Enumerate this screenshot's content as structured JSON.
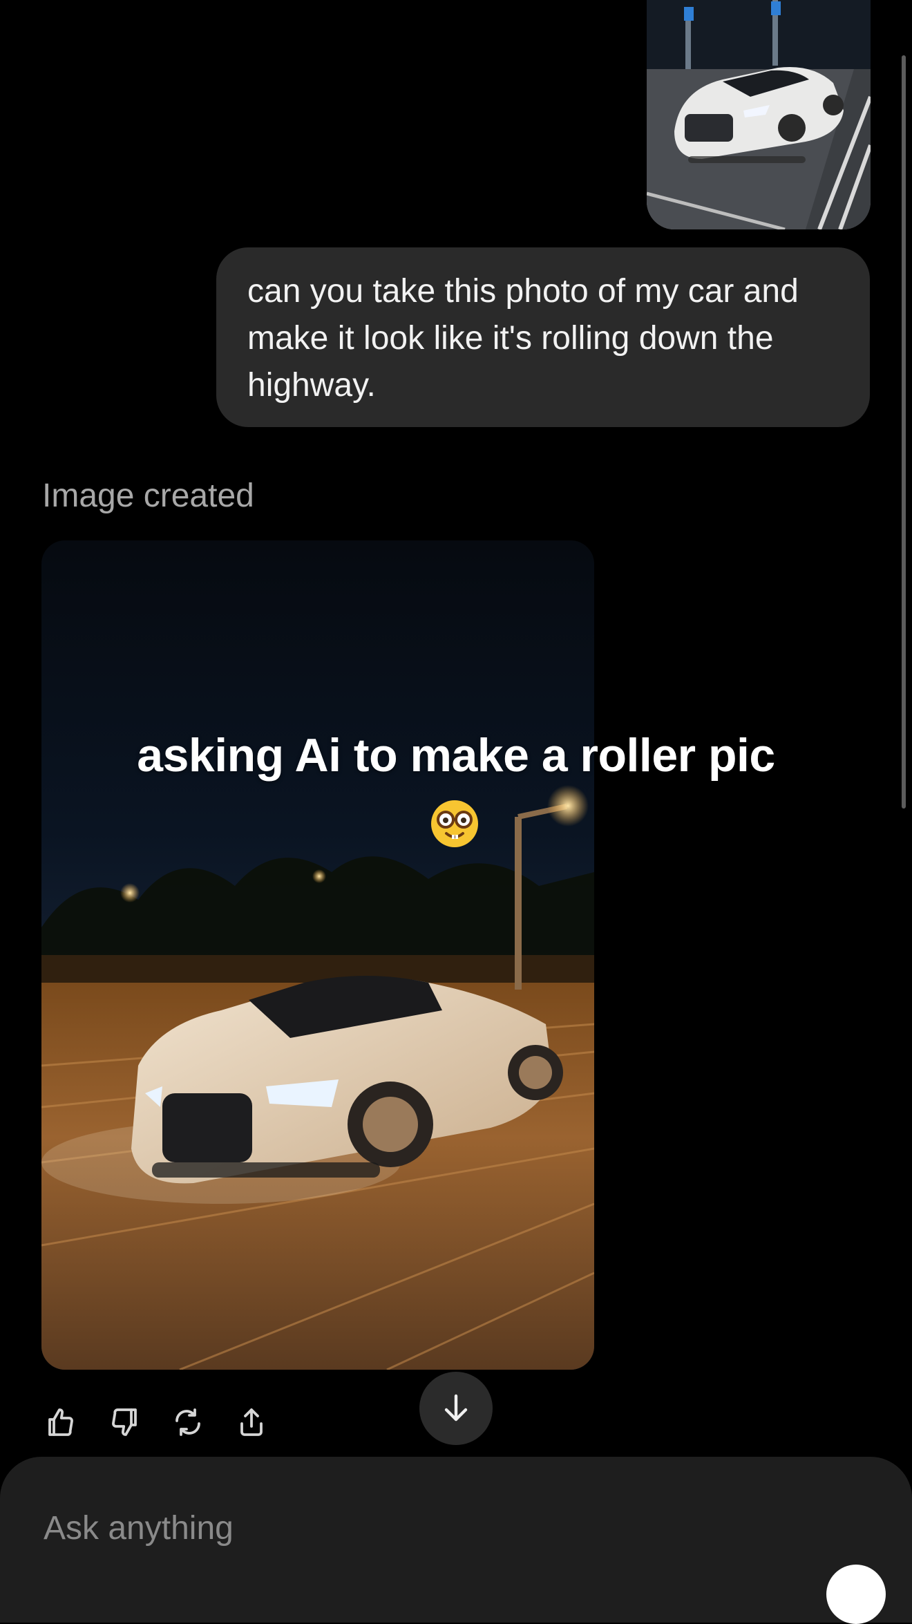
{
  "conversation": {
    "user_message": "can you take this photo of my car and make it look like it's rolling down the highway.",
    "image_created_label": "Image created",
    "generated_image": {
      "overlay_text": "asking Ai to make a roller pic",
      "overlay_emoji": "nerd-face-emoji"
    }
  },
  "actions": [
    {
      "name": "thumbs-up-icon"
    },
    {
      "name": "thumbs-down-icon"
    },
    {
      "name": "regenerate-icon"
    },
    {
      "name": "share-icon"
    }
  ],
  "scroll_down": {
    "icon": "arrow-down-icon"
  },
  "composer": {
    "placeholder": "Ask anything"
  },
  "colors": {
    "background": "#000000",
    "bubble": "#2a2a2a",
    "muted_text": "#a8a8a8",
    "composer": "#1e1e1e"
  }
}
